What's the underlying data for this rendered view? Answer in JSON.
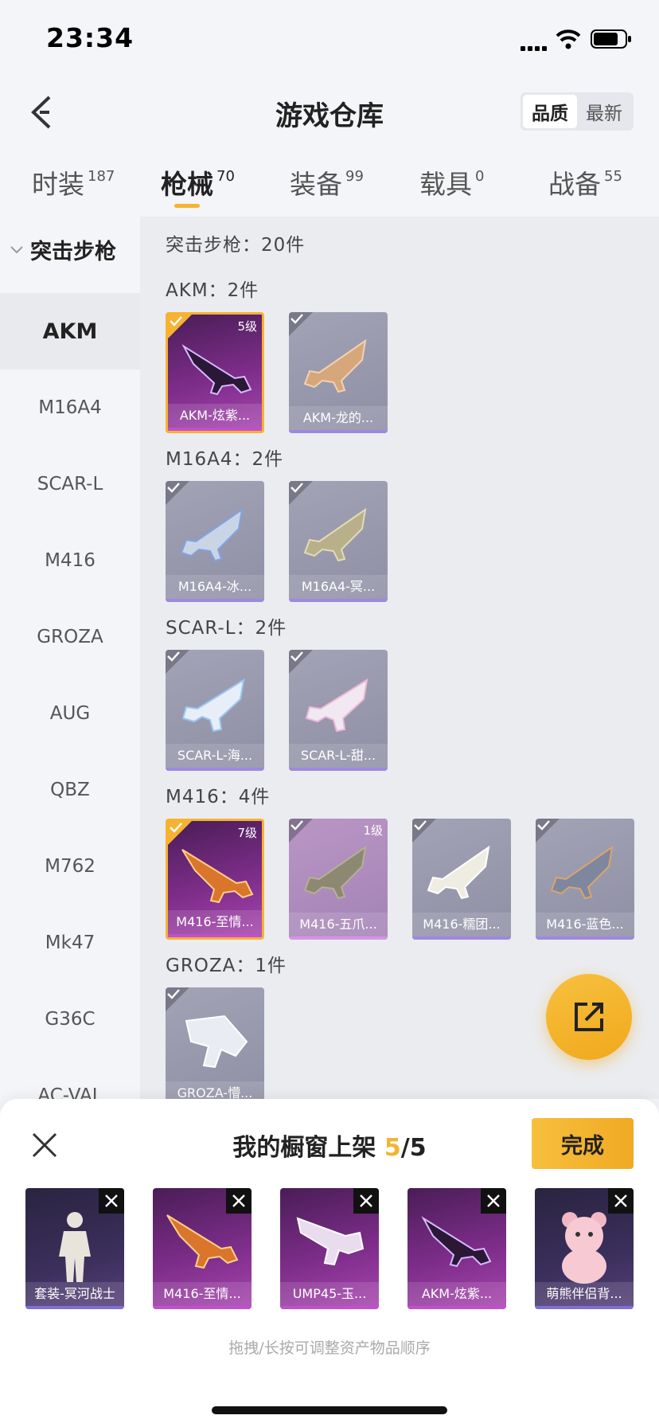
{
  "status": {
    "time": "23:34"
  },
  "header": {
    "title": "游戏仓库",
    "sort_options": [
      "品质",
      "最新"
    ],
    "sort_selected": "品质"
  },
  "tabs": [
    {
      "label": "时装",
      "count": "187"
    },
    {
      "label": "枪械",
      "count": "70",
      "active": true
    },
    {
      "label": "装备",
      "count": "99"
    },
    {
      "label": "载具",
      "count": "0"
    },
    {
      "label": "战备",
      "count": "55"
    }
  ],
  "sidebar": {
    "category": "突击步枪",
    "items": [
      "AKM",
      "M16A4",
      "SCAR-L",
      "M416",
      "GROZA",
      "AUG",
      "QBZ",
      "M762",
      "Mk47",
      "G36C",
      "AC-VAL"
    ],
    "selected": "AKM"
  },
  "main": {
    "summary": "突击步枪：20件",
    "groups": [
      {
        "label": "AKM：2件",
        "items": [
          {
            "name": "AKM-炫紫...",
            "level": "5级",
            "selected": true
          },
          {
            "name": "AKM-龙的..."
          }
        ]
      },
      {
        "label": "M16A4：2件",
        "items": [
          {
            "name": "M16A4-冰..."
          },
          {
            "name": "M16A4-冥..."
          }
        ]
      },
      {
        "label": "SCAR-L：2件",
        "items": [
          {
            "name": "SCAR-L-海..."
          },
          {
            "name": "SCAR-L-甜..."
          }
        ]
      },
      {
        "label": "M416：4件",
        "items": [
          {
            "name": "M416-至情...",
            "level": "7级",
            "selected": true
          },
          {
            "name": "M416-五爪...",
            "level": "1级"
          },
          {
            "name": "M416-糯团..."
          },
          {
            "name": "M416-蓝色..."
          }
        ]
      },
      {
        "label": "GROZA：1件",
        "items": [
          {
            "name": "GROZA-懵..."
          }
        ]
      }
    ]
  },
  "showcase": {
    "title": "我的橱窗上架",
    "current": "5",
    "sep": "/",
    "max": "5",
    "done_label": "完成",
    "items": [
      {
        "name": "套装-冥河战士",
        "icon": "outfit-figure-icon"
      },
      {
        "name": "M416-至情...",
        "icon": "rifle-icon"
      },
      {
        "name": "UMP45-玉...",
        "icon": "smg-icon"
      },
      {
        "name": "AKM-炫紫...",
        "icon": "rifle-icon"
      },
      {
        "name": "萌熊伴侣背...",
        "icon": "bear-backpack-icon"
      }
    ],
    "hint": "拖拽/长按可调整资产物品顺序"
  },
  "colors": {
    "accent": "#f5b331",
    "legendary": "#7d2d89",
    "common": "#9d88e0"
  }
}
